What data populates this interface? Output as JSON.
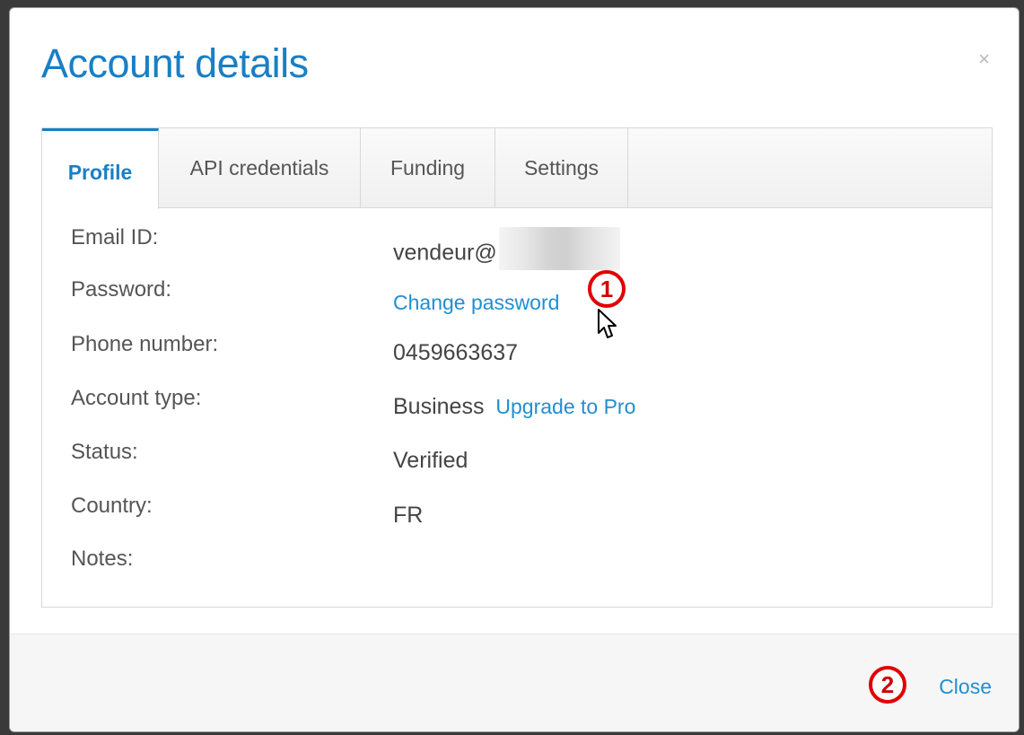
{
  "dialog": {
    "title": "Account details",
    "close_icon": "×"
  },
  "tabs": [
    {
      "label": "Profile",
      "active": true
    },
    {
      "label": "API credentials",
      "active": false
    },
    {
      "label": "Funding",
      "active": false
    },
    {
      "label": "Settings",
      "active": false
    }
  ],
  "profile": {
    "email_label": "Email ID:",
    "email_value": "vendeur@",
    "password_label": "Password:",
    "password_link": "Change password",
    "phone_label": "Phone number:",
    "phone_value": "0459663637",
    "account_type_label": "Account type:",
    "account_type_value": "Business",
    "upgrade_link": "Upgrade to Pro",
    "status_label": "Status:",
    "status_value": "Verified",
    "country_label": "Country:",
    "country_value": "FR",
    "notes_label": "Notes:"
  },
  "footer": {
    "close_label": "Close"
  },
  "annotations": {
    "marker1": "1",
    "marker2": "2"
  },
  "colors": {
    "accent": "#1a7fc4",
    "link": "#1f8fd1",
    "annotation": "#e00000"
  }
}
